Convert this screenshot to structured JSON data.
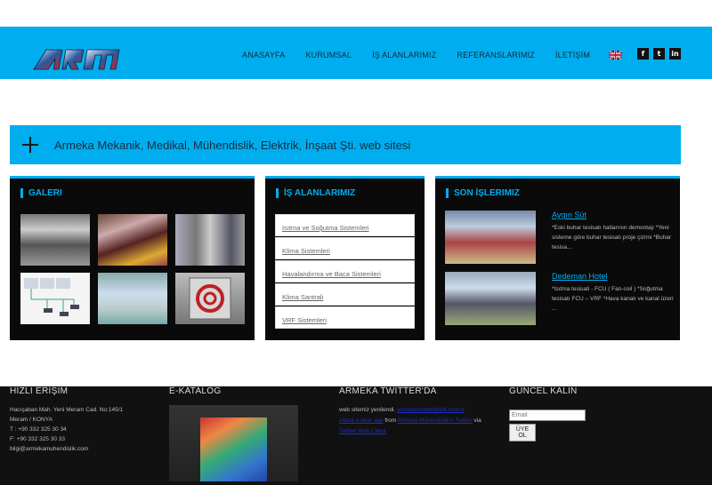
{
  "header": {
    "logo_text": "ARM",
    "nav": [
      "ANASAYFA",
      "KURUMSAL",
      "İŞ ALANLARIMIZ",
      "REFERANSLARIMIZ",
      "İLETİŞİM"
    ],
    "social": [
      "f",
      "t",
      "in"
    ]
  },
  "banner": {
    "text": "Armeka Mekanik, Medikal, Mühendislik, Elektrik, İnşaat Şti. web sitesi"
  },
  "galeri": {
    "title": "GALERI"
  },
  "is_alanlarimiz": {
    "title": "İŞ ALANLARIMIZ",
    "items": [
      "Isıtma ve Soğutma Sistemleri",
      "Klima Sistemleri",
      "Havalandırma ve Baca Sistemleri",
      "Klima Santrali",
      "VRF Sistemleri"
    ]
  },
  "son_islerimiz": {
    "title": "SON İŞLERIMIZ",
    "jobs": [
      {
        "title": "Aygın Süt",
        "desc": "*Eski buhar tesisatı hatlarının demontajı *Yeni sisteme göre buhar tesisatı proje çizimi *Buhar tesisa..."
      },
      {
        "title": "Dedeman Hotel",
        "desc": "*Isıtma tesisati - FCU ( Fan-coil ) *Soğutma tesisatı FCU – VRF *Hava kanalı ve kanal üzeri ..."
      }
    ]
  },
  "footer": {
    "hizli": {
      "title": "HIZLI ERIŞIM",
      "lines": [
        "Hacışaban Mah. Yeni Meram Cad. No:145/1",
        "Meram / KONYA",
        "T : +90 332 325 30 34",
        "F: +90 332 325 30 33",
        "bilgi@armekamuhendislik.com"
      ]
    },
    "katalog": {
      "title": "E-KATALOG"
    },
    "twitter": {
      "title": "ARMEKA TWITTER'DA",
      "line1_a": "web sitemiz yenilendi. ",
      "line1_link": "armekamuhendislik.com.tr",
      "line2_link1": "About a year ago",
      "line2_mid": " from ",
      "line2_link2": "Armeka Mühendislik's Twitter",
      "line2_end": " via",
      "line3_link": "Twitter Web Client"
    },
    "guncel": {
      "title": "GÜNCEL KALIN",
      "email_placeholder": "Email",
      "button": "ÜYE OL"
    }
  },
  "colors": {
    "accent": "#00aeef",
    "panel_bg": "#0a0a0a",
    "footer_bg": "#111111"
  }
}
